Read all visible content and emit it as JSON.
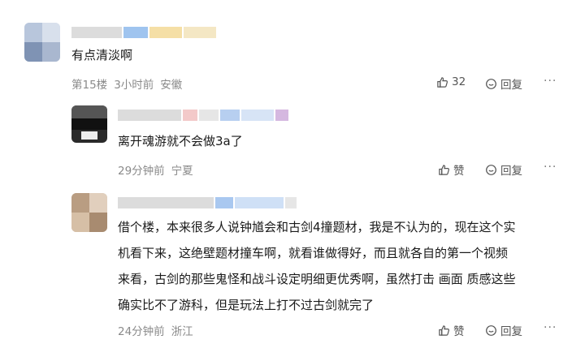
{
  "comments": [
    {
      "text": "有点清淡啊",
      "floor": "第15楼",
      "time": "3小时前",
      "location": "安徽",
      "like_count": "32",
      "reply_label": "回复",
      "more": "···"
    },
    {
      "text": "离开魂游就不会做3a了",
      "time": "29分钟前",
      "location": "宁夏",
      "like_label": "赞",
      "reply_label": "回复",
      "more": "···"
    },
    {
      "text_lines": [
        "借个楼，本来很多人说钟馗会和古剑4撞题材，我是不认为的，现在这个实",
        "机看下来，这绝壁题材撞车啊，就看谁做得好，而且就各自的第一个视频",
        "来看，古剑的那些鬼怪和战斗设定明细更优秀啊，虽然打击 画面 质感这些",
        "确实比不了游科，但是玩法上打不过古剑就完了"
      ],
      "time": "24分钟前",
      "location": "浙江",
      "like_label": "赞",
      "reply_label": "回复",
      "more": "···"
    }
  ]
}
